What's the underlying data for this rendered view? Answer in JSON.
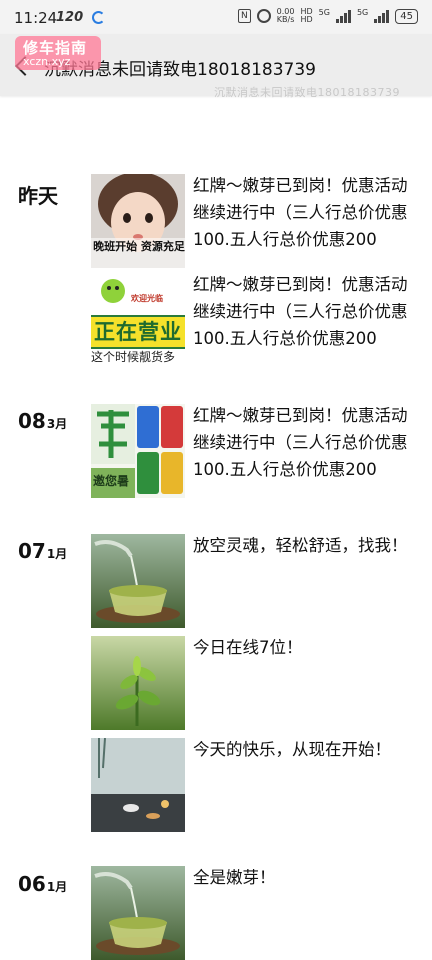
{
  "status_bar": {
    "time": "11:24",
    "speed_badge": "120",
    "net_speed_value": "0.00",
    "net_speed_unit": "KB/s",
    "hd_1": "HD",
    "hd_2": "HD",
    "signal_1_label": "5G",
    "signal_2_label": "5G",
    "battery": "45"
  },
  "watermark": {
    "title": "修车指南",
    "url": "xczn.xyz"
  },
  "header": {
    "title": "沉默消息未回请致电18018183739",
    "ghost_line": "沉默消息未回请致电18018183739"
  },
  "days": [
    {
      "day": "昨天",
      "month": ""
    },
    {
      "day": "08",
      "month": "3月"
    },
    {
      "day": "07",
      "month": "1月"
    },
    {
      "day": "06",
      "month": "1月"
    }
  ],
  "posts": [
    {
      "text": "红牌～嫩芽已到岗！优惠活动继续进行中（三人行总价优惠100.五人行总价优惠200",
      "thumb_caption": "晚班开始 资源充足",
      "thumb_kind": "child-photo"
    },
    {
      "text": "红牌～嫩芽已到岗！优惠活动继续进行中（三人行总价优惠100.五人行总价优惠200",
      "thumb_caption": "正在营业",
      "thumb_sub": "这个时候靓货多",
      "thumb_top": "欢迎光临",
      "thumb_kind": "open-sign"
    },
    {
      "text": "红牌～嫩芽已到岗！优惠活动继续进行中（三人行总价优惠100.五人行总价优惠200",
      "thumb_caption": "邀您暑",
      "thumb_kind": "tea-sign"
    },
    {
      "text": "放空灵魂，轻松舒适，找我！",
      "thumb_kind": "tea-cup"
    },
    {
      "text": "今日在线7位！",
      "thumb_kind": "tea-leaves"
    },
    {
      "text": "今天的快乐，从现在开始！",
      "thumb_kind": "tea-table"
    },
    {
      "text": "全是嫩芽！",
      "thumb_kind": "tea-cup"
    }
  ]
}
